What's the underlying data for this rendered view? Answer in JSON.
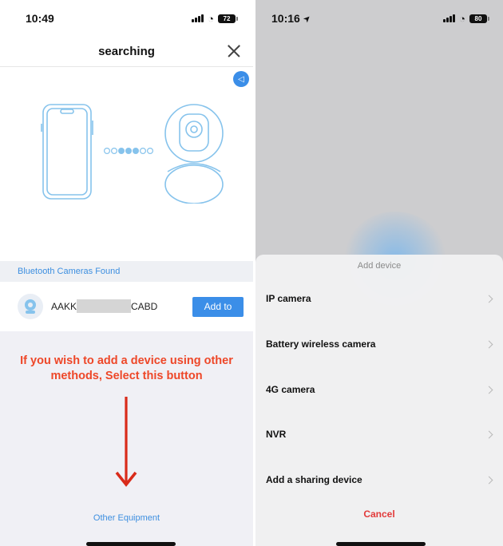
{
  "left": {
    "status": {
      "time": "10:49",
      "battery": "72"
    },
    "nav": {
      "title": "searching"
    },
    "section_title": "Bluetooth Cameras Found",
    "device": {
      "name": "AAKK",
      "suffix": "CABD",
      "add_label": "Add to"
    },
    "annotation": "If you wish to add a device using other methods, Select this button",
    "other_link": "Other Equipment"
  },
  "right": {
    "status": {
      "time": "10:16",
      "battery": "80"
    },
    "sheet": {
      "title": "Add device",
      "options": [
        "IP camera",
        "Battery wireless camera",
        "4G camera",
        "NVR",
        "Add a sharing device"
      ],
      "cancel_label": "Cancel"
    }
  },
  "colors": {
    "accent": "#3b8ee8",
    "annotation": "#ee4728",
    "cancel": "#e23a3a",
    "illustration": "#86c3ec"
  }
}
